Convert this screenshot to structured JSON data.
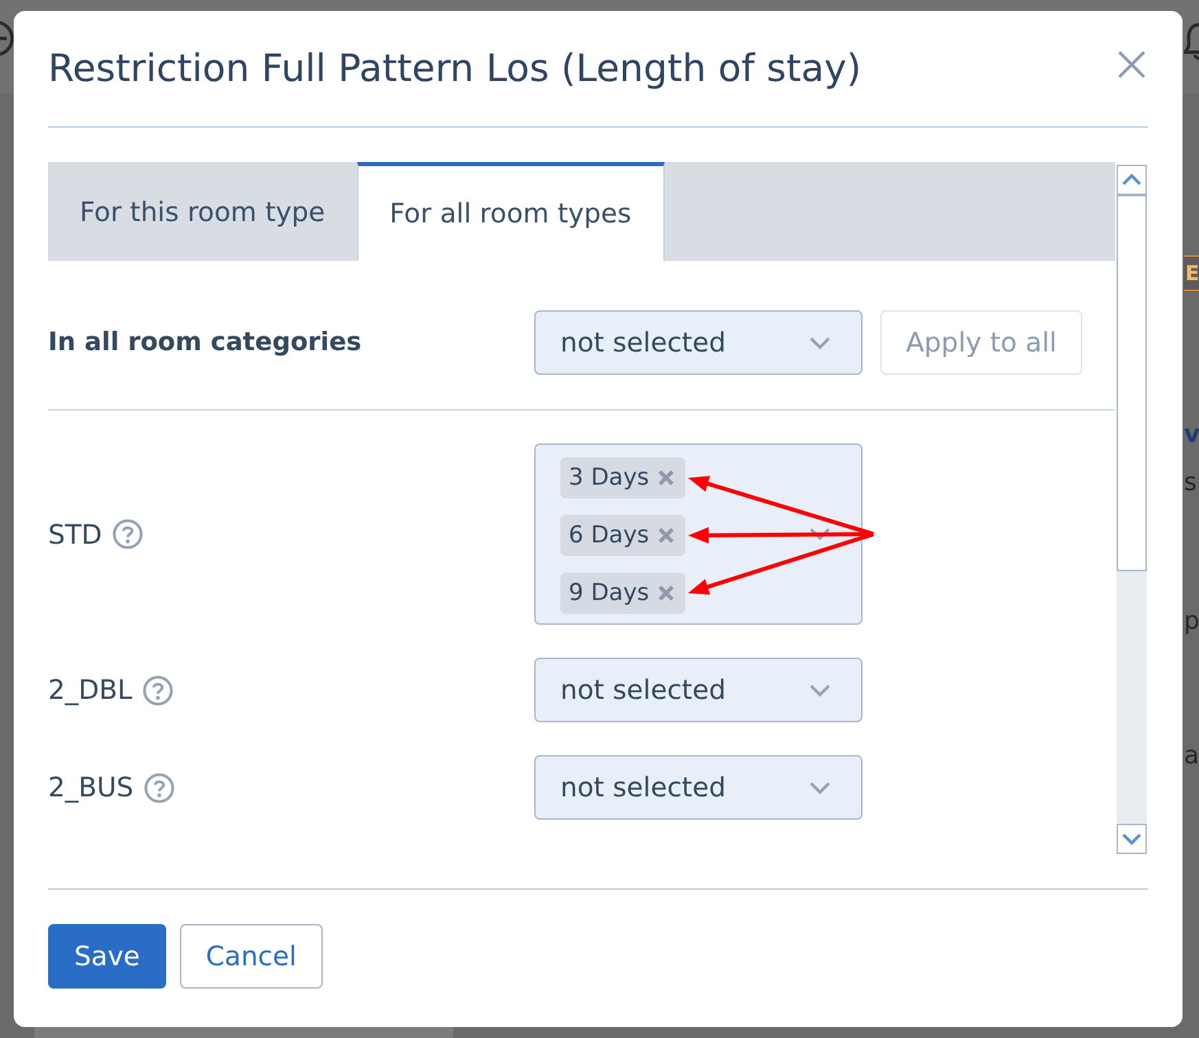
{
  "backdrop": {
    "side_fragments": [
      {
        "kind": "button",
        "text": "E"
      },
      {
        "kind": "heading",
        "text": "v"
      },
      {
        "kind": "text",
        "text": "s"
      },
      {
        "kind": "text",
        "text": "p"
      },
      {
        "kind": "text",
        "text": "a"
      }
    ]
  },
  "dialog": {
    "title": "Restriction Full Pattern Los (Length of stay)",
    "tabs": [
      {
        "label": "For this room type",
        "selected": false
      },
      {
        "label": "For all room types",
        "selected": true
      }
    ],
    "bulk": {
      "label": "In all room categories",
      "value": "not selected",
      "apply_button": {
        "label": "Apply to all",
        "disabled": true
      }
    },
    "rooms": [
      {
        "name": "STD",
        "kind": "multi",
        "tags": [
          {
            "label": "3 Days",
            "annotated": true
          },
          {
            "label": "6 Days",
            "annotated": true
          },
          {
            "label": "9 Days",
            "annotated": true
          }
        ]
      },
      {
        "name": "2_DBL",
        "kind": "single",
        "value": "not selected"
      },
      {
        "name": "2_BUS",
        "kind": "single",
        "value": "not selected"
      }
    ],
    "buttons": [
      {
        "label": "Save",
        "kind": "primary"
      },
      {
        "label": "Cancel",
        "kind": "secondary"
      }
    ]
  }
}
